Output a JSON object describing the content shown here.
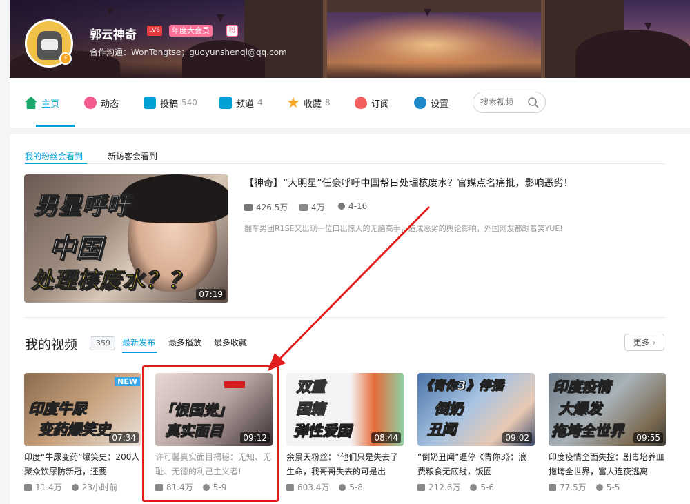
{
  "profile": {
    "name": "郭云神奇",
    "level": "LV6",
    "vip": "年度大会员",
    "fan_badge": "粉",
    "contact": "合作沟通：WonTongtse；guoyunshenqi@qq.com",
    "avatar_badge": "⚡"
  },
  "nav": {
    "items": [
      {
        "label": "主页",
        "count": "",
        "icon": "home-icon",
        "color": "#1aa86a"
      },
      {
        "label": "动态",
        "count": "",
        "icon": "dynamic-icon",
        "color": "#f45a8d"
      },
      {
        "label": "投稿",
        "count": "540",
        "icon": "upload-icon",
        "color": "#00a1d6"
      },
      {
        "label": "频道",
        "count": "4",
        "icon": "channel-icon",
        "color": "#00a1d6"
      },
      {
        "label": "收藏",
        "count": "8",
        "icon": "favorite-icon",
        "color": "#f6a623"
      },
      {
        "label": "订阅",
        "count": "",
        "icon": "subscribe-icon",
        "color": "#f25d5d"
      },
      {
        "label": "设置",
        "count": "",
        "icon": "settings-icon",
        "color": "#1e88c8"
      }
    ],
    "search_placeholder": "搜索视频"
  },
  "featured": {
    "tabs": [
      "我的粉丝会看到",
      "新访客会看到"
    ],
    "thumb_lines": [
      "男星呼吁",
      "中国",
      "处理核废水？？"
    ],
    "duration": "07:19",
    "title": "【神奇】“大明星”任豪呼吁中国帮日处理核废水？官媒点名痛批，影响恶劣！",
    "plays": "426.5万",
    "danmaku": "4万",
    "date": "4-16",
    "desc": "翻车男团R1SE又出现一位口出惊人的无脑高手，造成恶劣的舆论影响，外国网友都跟着笑YUE!"
  },
  "videos_section": {
    "title": "我的视频",
    "count": "359",
    "tabs": [
      "最新发布",
      "最多播放",
      "最多收藏"
    ],
    "more": "更多",
    "colors": {
      "accent": "#00a1d6",
      "highlight": "#e11d1d"
    },
    "videos": [
      {
        "thumb_lines": [
          "印度牛尿",
          "变药爆笑史"
        ],
        "badge": "NEW",
        "duration": "07:34",
        "title": "印度“牛尿变药”爆笑史：200人聚众饮尿防新冠，还要",
        "plays": "11.4万",
        "date": "23小时前"
      },
      {
        "thumb_lines": [
          "「恨国党」",
          "真实面目"
        ],
        "badge": "",
        "duration": "09:12",
        "title": "许可馨真实面目揭秘：无知、无耻、无德的利己主义者!",
        "plays": "81.4万",
        "date": "5-9"
      },
      {
        "thumb_lines": [
          "双重",
          "国籍",
          "弹性爱国"
        ],
        "badge": "",
        "duration": "08:44",
        "title": "余景天粉丝：“他们只是失去了生命，我哥哥失去的可是出",
        "plays": "603.4万",
        "date": "5-8"
      },
      {
        "thumb_lines": [
          "《青你3》停播",
          "倒奶",
          "丑闻"
        ],
        "badge": "",
        "duration": "09:02",
        "title": "“倒奶丑闻”逼停《青你3》：浪费粮食无底线，饭圈",
        "plays": "212.6万",
        "date": "5-6"
      },
      {
        "thumb_lines": [
          "印度疫情",
          "大爆发",
          "拖垮全世界"
        ],
        "badge": "",
        "duration": "09:55",
        "title": "印度疫情全面失控：剧毒培养皿拖垮全世界，富人连夜逃离",
        "plays": "77.5万",
        "date": "5-5"
      }
    ]
  }
}
